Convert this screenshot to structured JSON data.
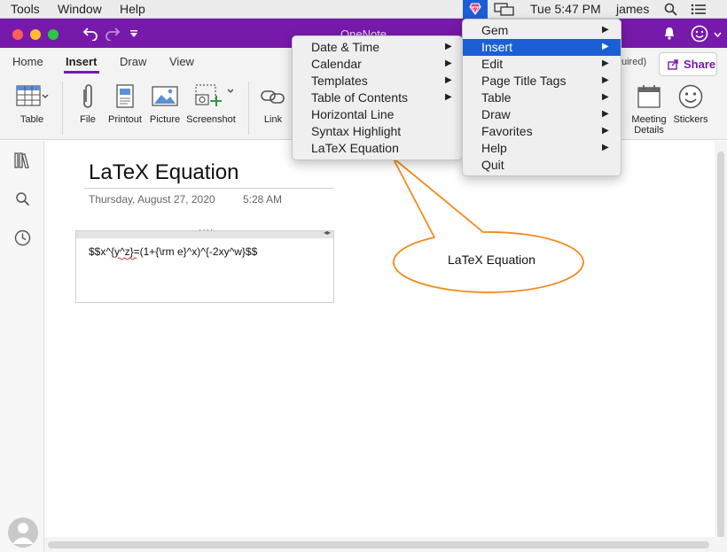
{
  "menubar": {
    "items": [
      "Tools",
      "Window",
      "Help"
    ],
    "clock": "Tue 5:47 PM",
    "user": "james"
  },
  "window": {
    "title": "OneNote"
  },
  "ribbon": {
    "tabs": [
      "Home",
      "Insert",
      "Draw",
      "View"
    ],
    "active_tab": "Insert",
    "buttons": {
      "table": "Table",
      "file": "File",
      "printout": "Printout",
      "picture": "Picture",
      "screenshot": "Screenshot",
      "link": "Link",
      "meeting": "Meeting",
      "details": "Details",
      "stickers": "Stickers"
    },
    "truncated_text": "uired)",
    "share": "Share"
  },
  "page": {
    "title": "LaTeX Equation",
    "date": "Thursday, August 27, 2020",
    "time": "5:28 AM",
    "note_text": "$$x^{y^z}=(1+{\\rm e}^x)^{-2xy^w}$$"
  },
  "gem_menu": {
    "items": [
      {
        "label": "Gem",
        "submenu": true
      },
      {
        "label": "Insert",
        "submenu": true,
        "highlighted": true
      },
      {
        "label": "Edit",
        "submenu": true
      },
      {
        "label": "Page Title Tags",
        "submenu": true
      },
      {
        "label": "Table",
        "submenu": true
      },
      {
        "label": "Draw",
        "submenu": true
      },
      {
        "label": "Favorites",
        "submenu": true
      },
      {
        "label": "Help",
        "submenu": true
      },
      {
        "label": "Quit",
        "submenu": false
      }
    ]
  },
  "insert_submenu": {
    "items": [
      {
        "label": "Date & Time",
        "submenu": true
      },
      {
        "label": "Calendar",
        "submenu": true
      },
      {
        "label": "Templates",
        "submenu": true
      },
      {
        "label": "Table of Contents",
        "submenu": true
      },
      {
        "label": "Horizontal Line",
        "submenu": false
      },
      {
        "label": "Syntax Highlight",
        "submenu": false
      },
      {
        "label": "LaTeX Equation",
        "submenu": false
      }
    ]
  },
  "callout": {
    "text": "LaTeX Equation"
  },
  "colors": {
    "brand": "#7719aa",
    "menu_highlight": "#1b5fd6",
    "callout_stroke": "#f08c1e"
  }
}
